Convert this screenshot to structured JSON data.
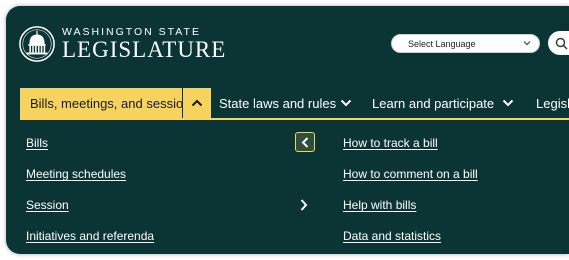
{
  "header": {
    "logo_line1": "WASHINGTON STATE",
    "logo_line2": "LEGISLATURE",
    "language_select": "Select Language"
  },
  "nav": {
    "items": [
      {
        "label": "Bills, meetings, and session",
        "active": true
      },
      {
        "label": "State laws and rules"
      },
      {
        "label": "Learn and participate"
      },
      {
        "label": "Legisla"
      }
    ]
  },
  "submenu": {
    "left": [
      "Bills",
      "Meeting schedules",
      "Session",
      "Initiatives and referenda"
    ],
    "right": [
      "How to track a bill",
      "How to comment on a bill",
      "Help with bills",
      "Data and statistics"
    ]
  },
  "colors": {
    "background": "#0b3534",
    "accent": "#f5d35e",
    "text": "#ffffff"
  },
  "icons": [
    "capitol-seal-icon",
    "search-icon",
    "chevron-up-icon",
    "chevron-down-icon",
    "chevron-left-icon",
    "chevron-right-icon"
  ]
}
